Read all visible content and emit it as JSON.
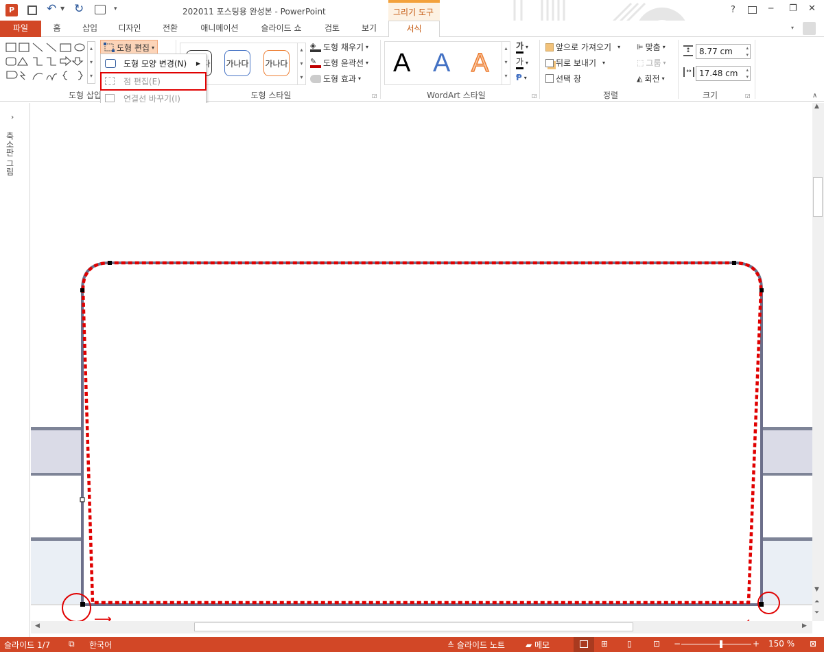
{
  "title": {
    "doc_title": "202011 포스팅용 완성본 - PowerPoint",
    "context_tab_group": "그리기 도구",
    "help": "?",
    "min": "─",
    "restore": "❐",
    "close": "✕"
  },
  "tabs": [
    "파일",
    "홈",
    "삽입",
    "디자인",
    "전환",
    "애니메이션",
    "슬라이드 쇼",
    "검토",
    "보기",
    "서식"
  ],
  "ribbon": {
    "edit_shape": "도형 편집",
    "shape_fill": "도형 채우기",
    "shape_outline": "도형 윤곽선",
    "shape_effects": "도형 효과",
    "style_sample": "가나다",
    "wordart_letter": "A",
    "bring_forward": "앞으로 가져오기",
    "send_backward": "뒤로 보내기",
    "selection_pane": "선택 창",
    "align": "맞춤",
    "group": "그룹",
    "rotate": "회전",
    "height": "8.77 cm",
    "width": "17.48 cm",
    "text_fill_label": "가",
    "text_outline_label": "가",
    "groups": {
      "insert_shapes": "도형 삽입",
      "shape_styles": "도형 스타일",
      "wordart_styles": "WordArt 스타일",
      "arrange": "정렬",
      "size": "크기"
    }
  },
  "dropdown": {
    "change_shape": "도형 모양 변경(N)",
    "edit_points": "점 편집(E)",
    "reroute": "연결선 바꾸기(I)"
  },
  "left_pane": {
    "label": "축소판 그림"
  },
  "status": {
    "slide": "슬라이드 1/7",
    "language": "한국어",
    "notes": "슬라이드 노트",
    "comments": "메모",
    "zoom": "150 %"
  },
  "colors": {
    "accent": "#d24726",
    "context_tab": "#f3a13b",
    "red_dash": "#e00000"
  }
}
